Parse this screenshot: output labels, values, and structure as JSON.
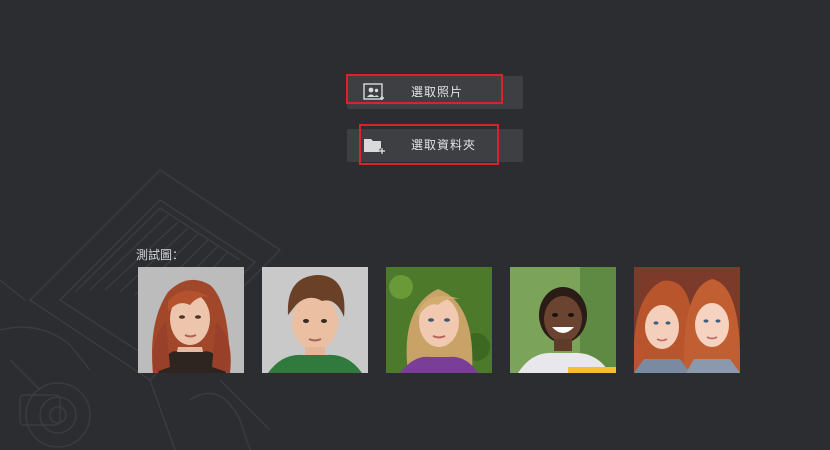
{
  "actions": {
    "select_photo_label": "選取照片",
    "select_folder_label": "選取資料夾"
  },
  "samples": {
    "heading": "測試圖："
  },
  "colors": {
    "background": "#2b2d31",
    "button": "#3d3f43",
    "highlight": "#d8232a",
    "text": "#e2e3e5"
  },
  "icons": {
    "select_photo": "person-photo-icon",
    "select_folder": "folder-add-icon"
  }
}
